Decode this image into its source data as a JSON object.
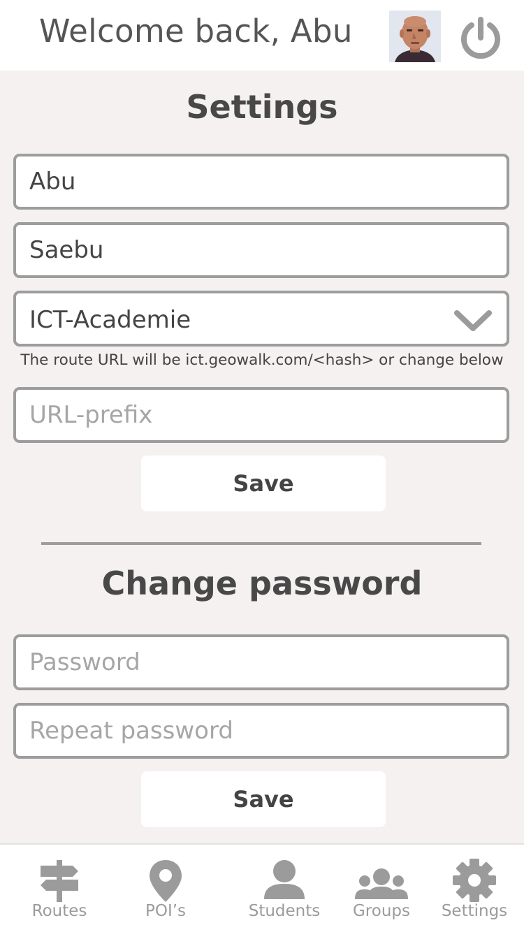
{
  "header": {
    "welcome_text": "Welcome back, Abu",
    "avatar_icon": "user-avatar-photo",
    "power_icon": "power-icon"
  },
  "settings": {
    "title": "Settings",
    "first_name_value": "Abu",
    "last_name_value": "Saebu",
    "organization_selected": "ICT-Academie",
    "hint": "The route URL will be ict.geowalk.com/<hash> or change below",
    "url_prefix_placeholder": "URL-prefix",
    "save_label": "Save"
  },
  "password": {
    "title": "Change password",
    "password_placeholder": "Password",
    "repeat_placeholder": "Repeat password",
    "save_label": "Save"
  },
  "nav": {
    "items": [
      {
        "label": "Routes",
        "icon": "signpost-icon"
      },
      {
        "label": "POI’s",
        "icon": "map-pin-icon"
      },
      {
        "label": "Students",
        "icon": "person-icon"
      },
      {
        "label": "Groups",
        "icon": "group-icon"
      },
      {
        "label": "Settings",
        "icon": "gear-icon"
      }
    ]
  },
  "colors": {
    "background": "#f4f1f0",
    "border": "#9d9d9d",
    "text": "#484848",
    "icon": "#9b9b9b"
  }
}
